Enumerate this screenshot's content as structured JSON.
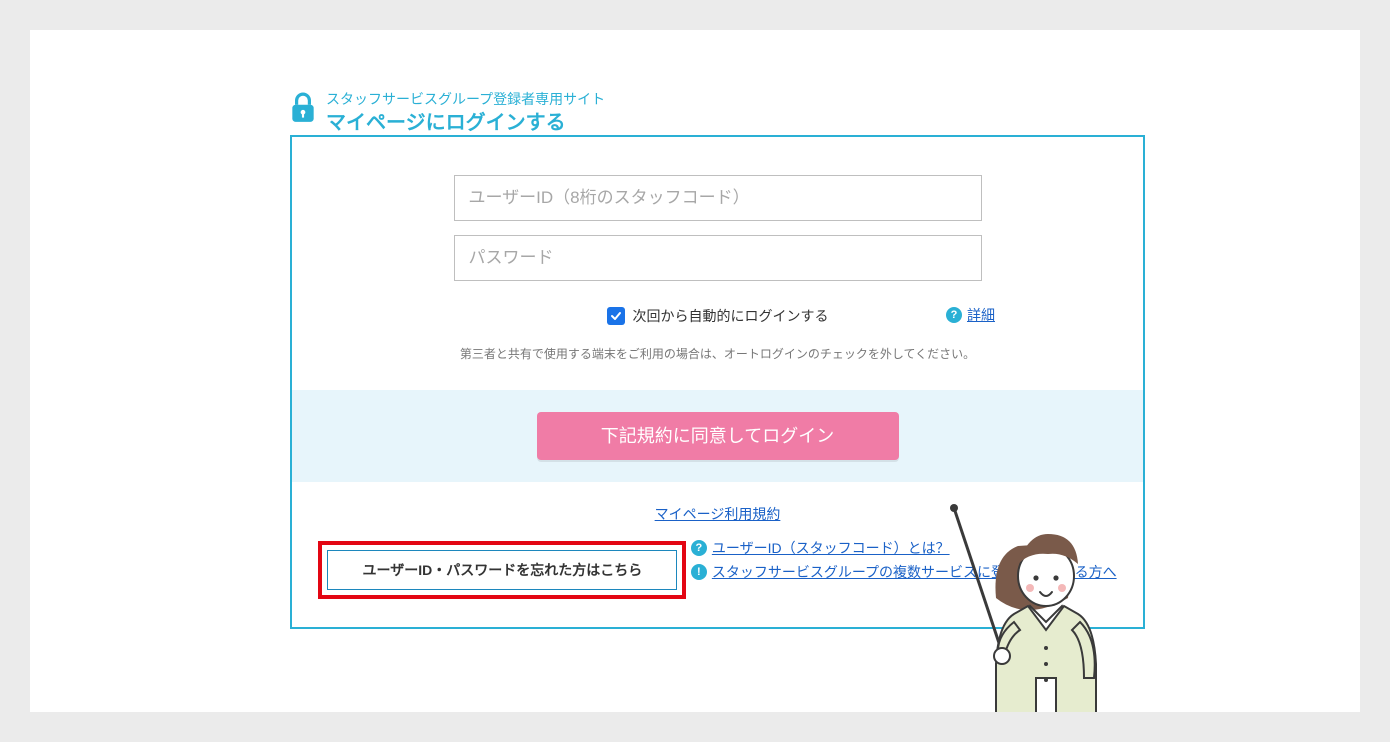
{
  "header": {
    "subtitle": "スタッフサービスグループ登録者専用サイト",
    "title": "マイページにログインする"
  },
  "form": {
    "userid_placeholder": "ユーザーID（8桁のスタッフコード）",
    "password_placeholder": "パスワード",
    "auto_login_label": "次回から自動的にログインする",
    "auto_login_checked": true,
    "detail_link": "詳細",
    "share_note": "第三者と共有で使用する端末をご利用の場合は、オートログインのチェックを外してください。",
    "login_button": "下記規約に同意してログイン"
  },
  "links": {
    "tos": "マイページ利用規約",
    "forgot": "ユーザーID・パスワードを忘れた方はこちら",
    "what_is_userid": "ユーザーID（スタッフコード）とは？",
    "multi_service": "スタッフサービスグループの複数サービスに登録されている方へ"
  },
  "icons": {
    "question": "?",
    "info": "!"
  },
  "colors": {
    "brand": "#2ab0d5",
    "button": "#f07ca6",
    "highlight_border": "#e30613",
    "link": "#1a61c7"
  }
}
